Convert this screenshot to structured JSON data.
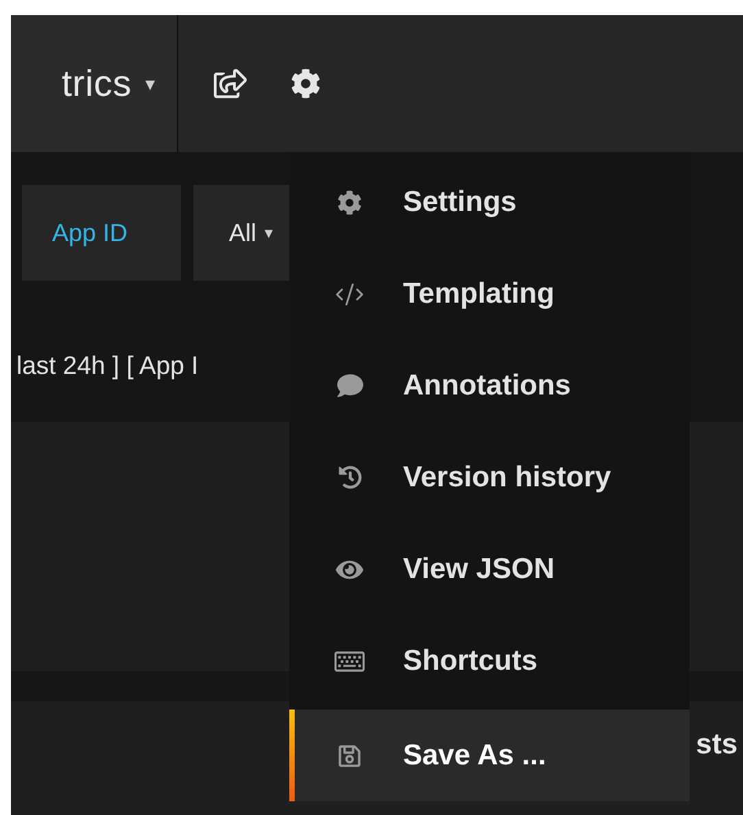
{
  "navbar": {
    "dashboard_title": "trics",
    "dashboard_caret": "▾"
  },
  "variables": [
    {
      "label": "App ID",
      "kind": "label"
    },
    {
      "label": "All",
      "kind": "dropdown",
      "caret": "▾"
    }
  ],
  "title_line": "last 24h ] [ App I",
  "settings_menu": {
    "items": [
      {
        "label": "Settings",
        "selected": false
      },
      {
        "label": "Templating",
        "selected": false
      },
      {
        "label": "Annotations",
        "selected": false
      },
      {
        "label": "Version history",
        "selected": false
      },
      {
        "label": "View JSON",
        "selected": false
      },
      {
        "label": "Shortcuts",
        "selected": false
      },
      {
        "label": "Save As ...",
        "selected": true
      }
    ]
  },
  "panel_title_fragment": "sts"
}
